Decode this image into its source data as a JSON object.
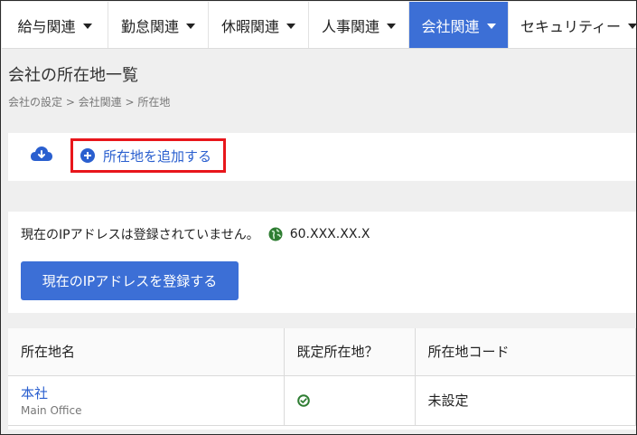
{
  "nav": {
    "items": [
      {
        "label": "給与関連"
      },
      {
        "label": "勤怠関連"
      },
      {
        "label": "休暇関連"
      },
      {
        "label": "人事関連"
      },
      {
        "label": "会社関連"
      },
      {
        "label": "セキュリティー"
      }
    ],
    "active_index": 4,
    "active_color": "#3c6fd6"
  },
  "page": {
    "title": "会社の所在地一覧",
    "breadcrumb": "会社の設定 > 会社関連 > 所在地"
  },
  "actions": {
    "download_icon": "cloud-download-icon",
    "add_label": "所在地を追加する",
    "add_icon": "plus-circle-icon",
    "highlight_color": "#e8161b"
  },
  "ip": {
    "message": "現在のIPアドレスは登録されていません。",
    "globe_icon": "globe-icon",
    "address": "60.XXX.XX.X",
    "register_label": "現在のIPアドレスを登録する"
  },
  "table": {
    "headers": [
      "所在地名",
      "既定所在地？",
      "所在地コード"
    ],
    "rows": [
      {
        "name": "本社",
        "subname": "Main Office",
        "default_icon": "check-circle-icon",
        "code": "未設定"
      }
    ]
  }
}
